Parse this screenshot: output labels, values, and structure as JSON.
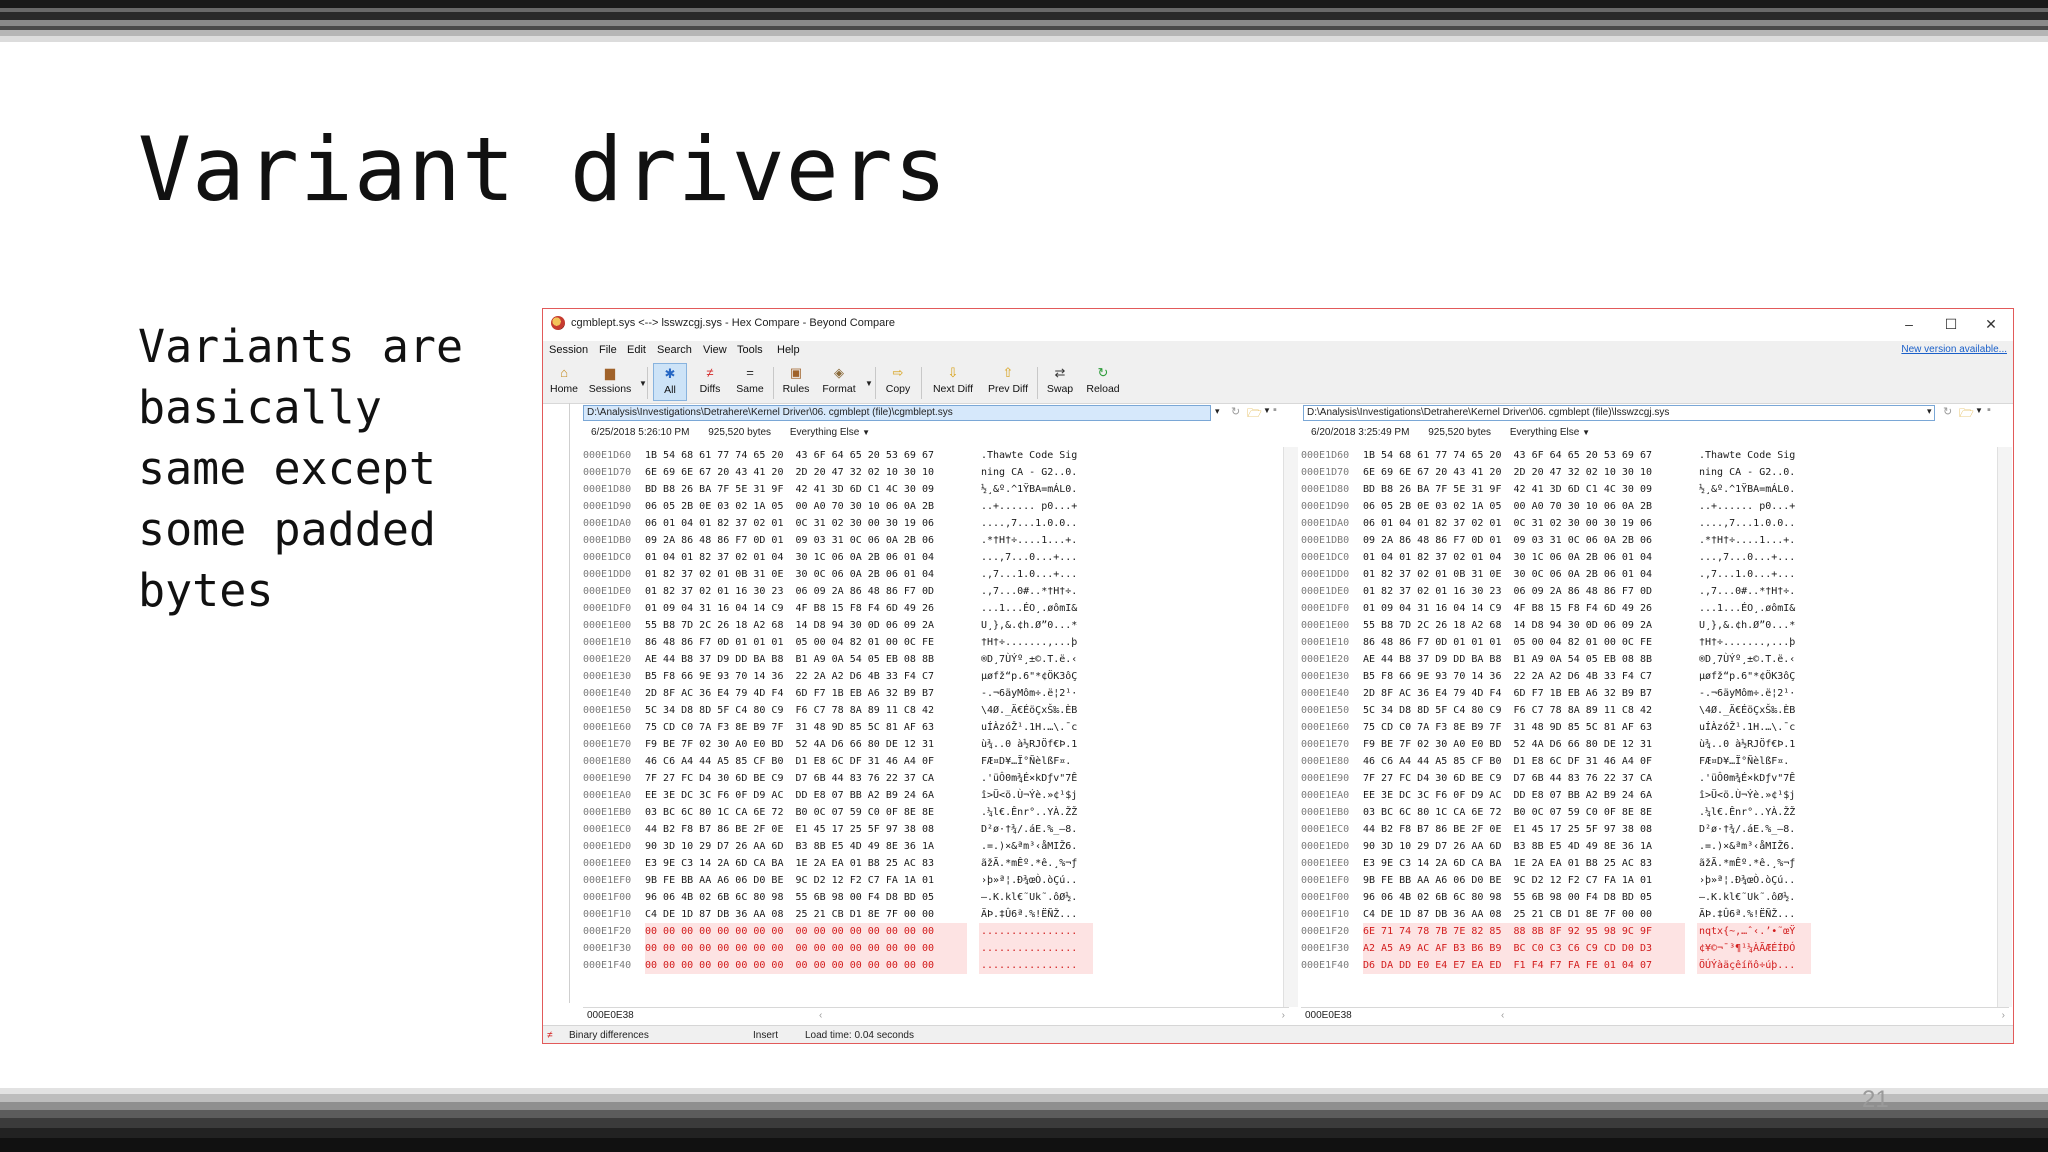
{
  "slide": {
    "title": "Variant drivers",
    "body": "Variants are basically same except some padded bytes",
    "page_number": "21"
  },
  "window": {
    "title": "cgmblept.sys <--> lsswzcgj.sys - Hex Compare - Beyond Compare",
    "controls": {
      "minimize": "–",
      "maximize": "☐",
      "close": "✕"
    }
  },
  "menu": {
    "items": [
      "Session",
      "File",
      "Edit",
      "Search",
      "View",
      "Tools",
      "Help"
    ],
    "new_version": "New version available..."
  },
  "toolbar": {
    "home": "Home",
    "sessions": "Sessions",
    "all": "All",
    "diffs": "Diffs",
    "same": "Same",
    "rules": "Rules",
    "format": "Format",
    "copy": "Copy",
    "next_diff": "Next Diff",
    "prev_diff": "Prev Diff",
    "swap": "Swap",
    "reload": "Reload"
  },
  "left": {
    "path": "D:\\Analysis\\Investigations\\Detrahere\\Kernel Driver\\06. cgmblept (file)\\cgmblept.sys",
    "date": "6/25/2018 5:26:10 PM",
    "size": "925,520 bytes",
    "filter": "Everything Else",
    "offset": "000E0E38"
  },
  "right": {
    "path": "D:\\Analysis\\Investigations\\Detrahere\\Kernel Driver\\06. cgmblept (file)\\lsswzcgj.sys",
    "date": "6/20/2018 3:25:49 PM",
    "size": "925,520 bytes",
    "filter": "Everything Else",
    "offset": "000E0E38"
  },
  "hex": {
    "common_rows": [
      {
        "addr": "000E1D60",
        "bytes": "1B 54 68 61 77 74 65 20  43 6F 64 65 20 53 69 67",
        "ascii": ".Thawte Code Sig"
      },
      {
        "addr": "000E1D70",
        "bytes": "6E 69 6E 67 20 43 41 20  2D 20 47 32 02 10 30 10",
        "ascii": "ning CA - G2..0."
      },
      {
        "addr": "000E1D80",
        "bytes": "BD B8 26 BA 7F 5E 31 9F  42 41 3D 6D C1 4C 30 09",
        "ascii": "½¸&º.^1ŸBA=mÁL0."
      },
      {
        "addr": "000E1D90",
        "bytes": "06 05 2B 0E 03 02 1A 05  00 A0 70 30 10 06 0A 2B",
        "ascii": "..+...... p0...+"
      },
      {
        "addr": "000E1DA0",
        "bytes": "06 01 04 01 82 37 02 01  0C 31 02 30 00 30 19 06",
        "ascii": "....‚7...1.0.0.."
      },
      {
        "addr": "000E1DB0",
        "bytes": "09 2A 86 48 86 F7 0D 01  09 03 31 0C 06 0A 2B 06",
        "ascii": ".*†H†÷....1...+."
      },
      {
        "addr": "000E1DC0",
        "bytes": "01 04 01 82 37 02 01 04  30 1C 06 0A 2B 06 01 04",
        "ascii": "...‚7...0...+..."
      },
      {
        "addr": "000E1DD0",
        "bytes": "01 82 37 02 01 0B 31 0E  30 0C 06 0A 2B 06 01 04",
        "ascii": ".‚7...1.0...+..."
      },
      {
        "addr": "000E1DE0",
        "bytes": "01 82 37 02 01 16 30 23  06 09 2A 86 48 86 F7 0D",
        "ascii": ".‚7...0#..*†H†÷."
      },
      {
        "addr": "000E1DF0",
        "bytes": "01 09 04 31 16 04 14 C9  4F B8 15 F8 F4 6D 49 26",
        "ascii": "...1...ÉO¸.øômI&"
      },
      {
        "addr": "000E1E00",
        "bytes": "55 B8 7D 2C 26 18 A2 68  14 D8 94 30 0D 06 09 2A",
        "ascii": "U¸},&.¢h.Ø”0...*"
      },
      {
        "addr": "000E1E10",
        "bytes": "86 48 86 F7 0D 01 01 01  05 00 04 82 01 00 0C FE",
        "ascii": "†H†÷.......‚...þ"
      },
      {
        "addr": "000E1E20",
        "bytes": "AE 44 B8 37 D9 DD BA B8  B1 A9 0A 54 05 EB 08 8B",
        "ascii": "®D¸7ÙÝº¸±©.T.ë.‹"
      },
      {
        "addr": "000E1E30",
        "bytes": "B5 F8 66 9E 93 70 14 36  22 2A A2 D6 4B 33 F4 C7",
        "ascii": "µøfž“p.6\"*¢ÖK3ôÇ"
      },
      {
        "addr": "000E1E40",
        "bytes": "2D 8F AC 36 E4 79 4D F4  6D F7 1B EB A6 32 B9 B7",
        "ascii": "-.¬6äyMôm÷.ë¦2¹·"
      },
      {
        "addr": "000E1E50",
        "bytes": "5C 34 D8 8D 5F C4 80 C9  F6 C7 78 8A 89 11 C8 42",
        "ascii": "\\4Ø._Ä€ÉöÇxŠ‰.ÈB"
      },
      {
        "addr": "000E1E60",
        "bytes": "75 CD C0 7A F3 8E B9 7F  31 48 9D 85 5C 81 AF 63",
        "ascii": "uÍÀzóŽ¹.1H.…\\.¯c"
      },
      {
        "addr": "000E1E70",
        "bytes": "F9 BE 7F 02 30 A0 E0 BD  52 4A D6 66 80 DE 12 31",
        "ascii": "ù¾..0 à½RJÖf€Þ.1"
      },
      {
        "addr": "000E1E80",
        "bytes": "46 C6 A4 44 A5 85 CF B0  D1 E8 6C DF 31 46 A4 0F",
        "ascii": "FÆ¤D¥…Ï°ÑèlßF¤."
      },
      {
        "addr": "000E1E90",
        "bytes": "7F 27 FC D4 30 6D BE C9  D7 6B 44 83 76 22 37 CA",
        "ascii": ".'üÔ0m¾É×kDƒv\"7Ê"
      },
      {
        "addr": "000E1EA0",
        "bytes": "EE 3E DC 3C F6 0F D9 AC  DD E8 07 BB A2 B9 24 6A",
        "ascii": "î>Ü<ö.Ù¬Ýè.»¢¹$j"
      },
      {
        "addr": "000E1EB0",
        "bytes": "03 BC 6C 80 1C CA 6E 72  B0 0C 07 59 C0 0F 8E 8E",
        "ascii": ".¼l€.Ênr°..YÀ.ŽŽ"
      },
      {
        "addr": "000E1EC0",
        "bytes": "44 B2 F8 B7 86 BE 2F 0E  E1 45 17 25 5F 97 38 08",
        "ascii": "D²ø·†¾/.áE.%_—8."
      },
      {
        "addr": "000E1ED0",
        "bytes": "90 3D 10 29 D7 26 AA 6D  B3 8B E5 4D 49 8E 36 1A",
        "ascii": ".=.)×&ªm³‹åMIŽ6."
      },
      {
        "addr": "000E1EE0",
        "bytes": "E3 9E C3 14 2A 6D CA BA  1E 2A EA 01 B8 25 AC 83",
        "ascii": "ãžÃ.*mÊº.*ê.¸%¬ƒ"
      },
      {
        "addr": "000E1EF0",
        "bytes": "9B FE BB AA A6 06 D0 BE  9C D2 12 F2 C7 FA 1A 01",
        "ascii": "›þ»ª¦.Ð¾œÒ.òÇú.."
      },
      {
        "addr": "000E1F00",
        "bytes": "96 06 4B 02 6B 6C 80 98  55 6B 98 00 F4 D8 BD 05",
        "ascii": "–.K.kl€˜Uk˜.ôØ½."
      },
      {
        "addr": "000E1F10",
        "bytes": "C4 DE 1D 87 DB 36 AA 08  25 21 CB D1 8E 7F 00 00",
        "ascii": "ÄÞ.‡Û6ª.%!ËÑŽ..."
      }
    ],
    "left_diff_rows": [
      {
        "addr": "000E1F20",
        "bytes": "00 00 00 00 00 00 00 00  00 00 00 00 00 00 00 00",
        "ascii": "................"
      },
      {
        "addr": "000E1F30",
        "bytes": "00 00 00 00 00 00 00 00  00 00 00 00 00 00 00 00",
        "ascii": "................"
      },
      {
        "addr": "000E1F40",
        "bytes": "00 00 00 00 00 00 00 00  00 00 00 00 00 00 00 00",
        "ascii": "................"
      }
    ],
    "right_diff_rows": [
      {
        "addr": "000E1F20",
        "bytes": "6E 71 74 78 7B 7E 82 85  88 8B 8F 92 95 98 9C 9F",
        "ascii": "nqtx{~‚…ˆ‹.’•˜œŸ"
      },
      {
        "addr": "000E1F30",
        "bytes": "A2 A5 A9 AC AF B3 B6 B9  BC C0 C3 C6 C9 CD D0 D3",
        "ascii": "¢¥©¬¯³¶¹¼ÀÃÆÉÍÐÓ"
      },
      {
        "addr": "000E1F40",
        "bytes": "D6 DA DD E0 E4 E7 EA ED  F1 F4 F7 FA FE 01 04 07",
        "ascii": "ÖÚÝàäçêíñô÷úþ..."
      }
    ]
  },
  "status": {
    "mode": "Binary differences",
    "insert": "Insert",
    "load_time": "Load time: 0.04 seconds"
  }
}
